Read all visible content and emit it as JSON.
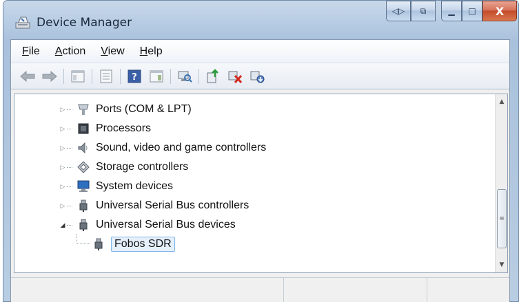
{
  "window": {
    "title": "Device Manager",
    "icon": "device-manager-icon"
  },
  "title_buttons": [
    {
      "name": "back-forward-tab-icon",
      "glyph": "◁▷"
    },
    {
      "name": "snap-icon",
      "glyph": "⧉"
    },
    {
      "name": "minimize-icon",
      "glyph": "▁"
    },
    {
      "name": "maximize-icon",
      "glyph": "□"
    },
    {
      "name": "close-icon",
      "glyph": "X"
    }
  ],
  "menu": [
    {
      "accel": "F",
      "rest": "ile"
    },
    {
      "accel": "A",
      "rest": "ction"
    },
    {
      "accel": "V",
      "rest": "iew"
    },
    {
      "accel": "H",
      "rest": "elp"
    }
  ],
  "toolbar": [
    "back-arrow-icon",
    "forward-arrow-icon",
    "show-hide-console-tree-icon",
    "properties-icon",
    "help-icon",
    "action-pane-icon",
    "scan-hardware-icon",
    "update-driver-icon",
    "disable-device-icon",
    "uninstall-device-icon"
  ],
  "tree": {
    "items": [
      {
        "label": "Ports (COM & LPT)",
        "icon": "port-icon",
        "expanded": false
      },
      {
        "label": "Processors",
        "icon": "processor-icon",
        "expanded": false
      },
      {
        "label": "Sound, video and game controllers",
        "icon": "speaker-icon",
        "expanded": false
      },
      {
        "label": "Storage controllers",
        "icon": "storage-icon",
        "expanded": false
      },
      {
        "label": "System devices",
        "icon": "computer-icon",
        "expanded": false
      },
      {
        "label": "Universal Serial Bus controllers",
        "icon": "usb-plug-icon",
        "expanded": false
      },
      {
        "label": "Universal Serial Bus devices",
        "icon": "usb-plug-icon",
        "expanded": true
      }
    ],
    "child": {
      "label": "Fobos SDR",
      "icon": "usb-plug-icon",
      "selected": true
    }
  },
  "colors": {
    "selection_border": "#7eb4ea",
    "selection_fill": "#e5f0fb",
    "close_button": "#c44b2b"
  }
}
